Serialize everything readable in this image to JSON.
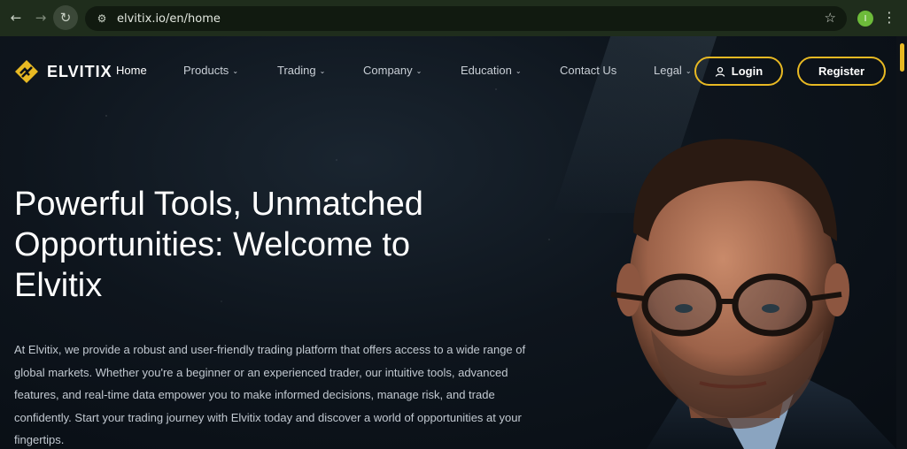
{
  "browser": {
    "url": "elvitix.io/en/home",
    "profile_initial": "I",
    "back_icon": "back-arrow-icon",
    "forward_icon": "forward-arrow-icon",
    "reload_icon": "reload-icon"
  },
  "brand": {
    "name": "ELVITIX",
    "accent_color": "#e8b923"
  },
  "nav": {
    "home": "Home",
    "products": "Products",
    "trading": "Trading",
    "company": "Company",
    "education": "Education",
    "contact": "Contact Us",
    "legal": "Legal"
  },
  "actions": {
    "login": "Login",
    "register": "Register"
  },
  "hero": {
    "title_line1": "Powerful Tools, Unmatched",
    "title_line2": "Opportunities: Welcome to",
    "title_line3": "Elvitix",
    "body": "At Elvitix, we provide a robust and user-friendly trading platform that offers access to a wide range of global markets. Whether you're a beginner or an experienced trader, our intuitive tools, advanced features, and real-time data empower you to make informed decisions, manage risk, and trade confidently. Start your trading journey with Elvitix today and discover a world of opportunities at your fingertips."
  }
}
